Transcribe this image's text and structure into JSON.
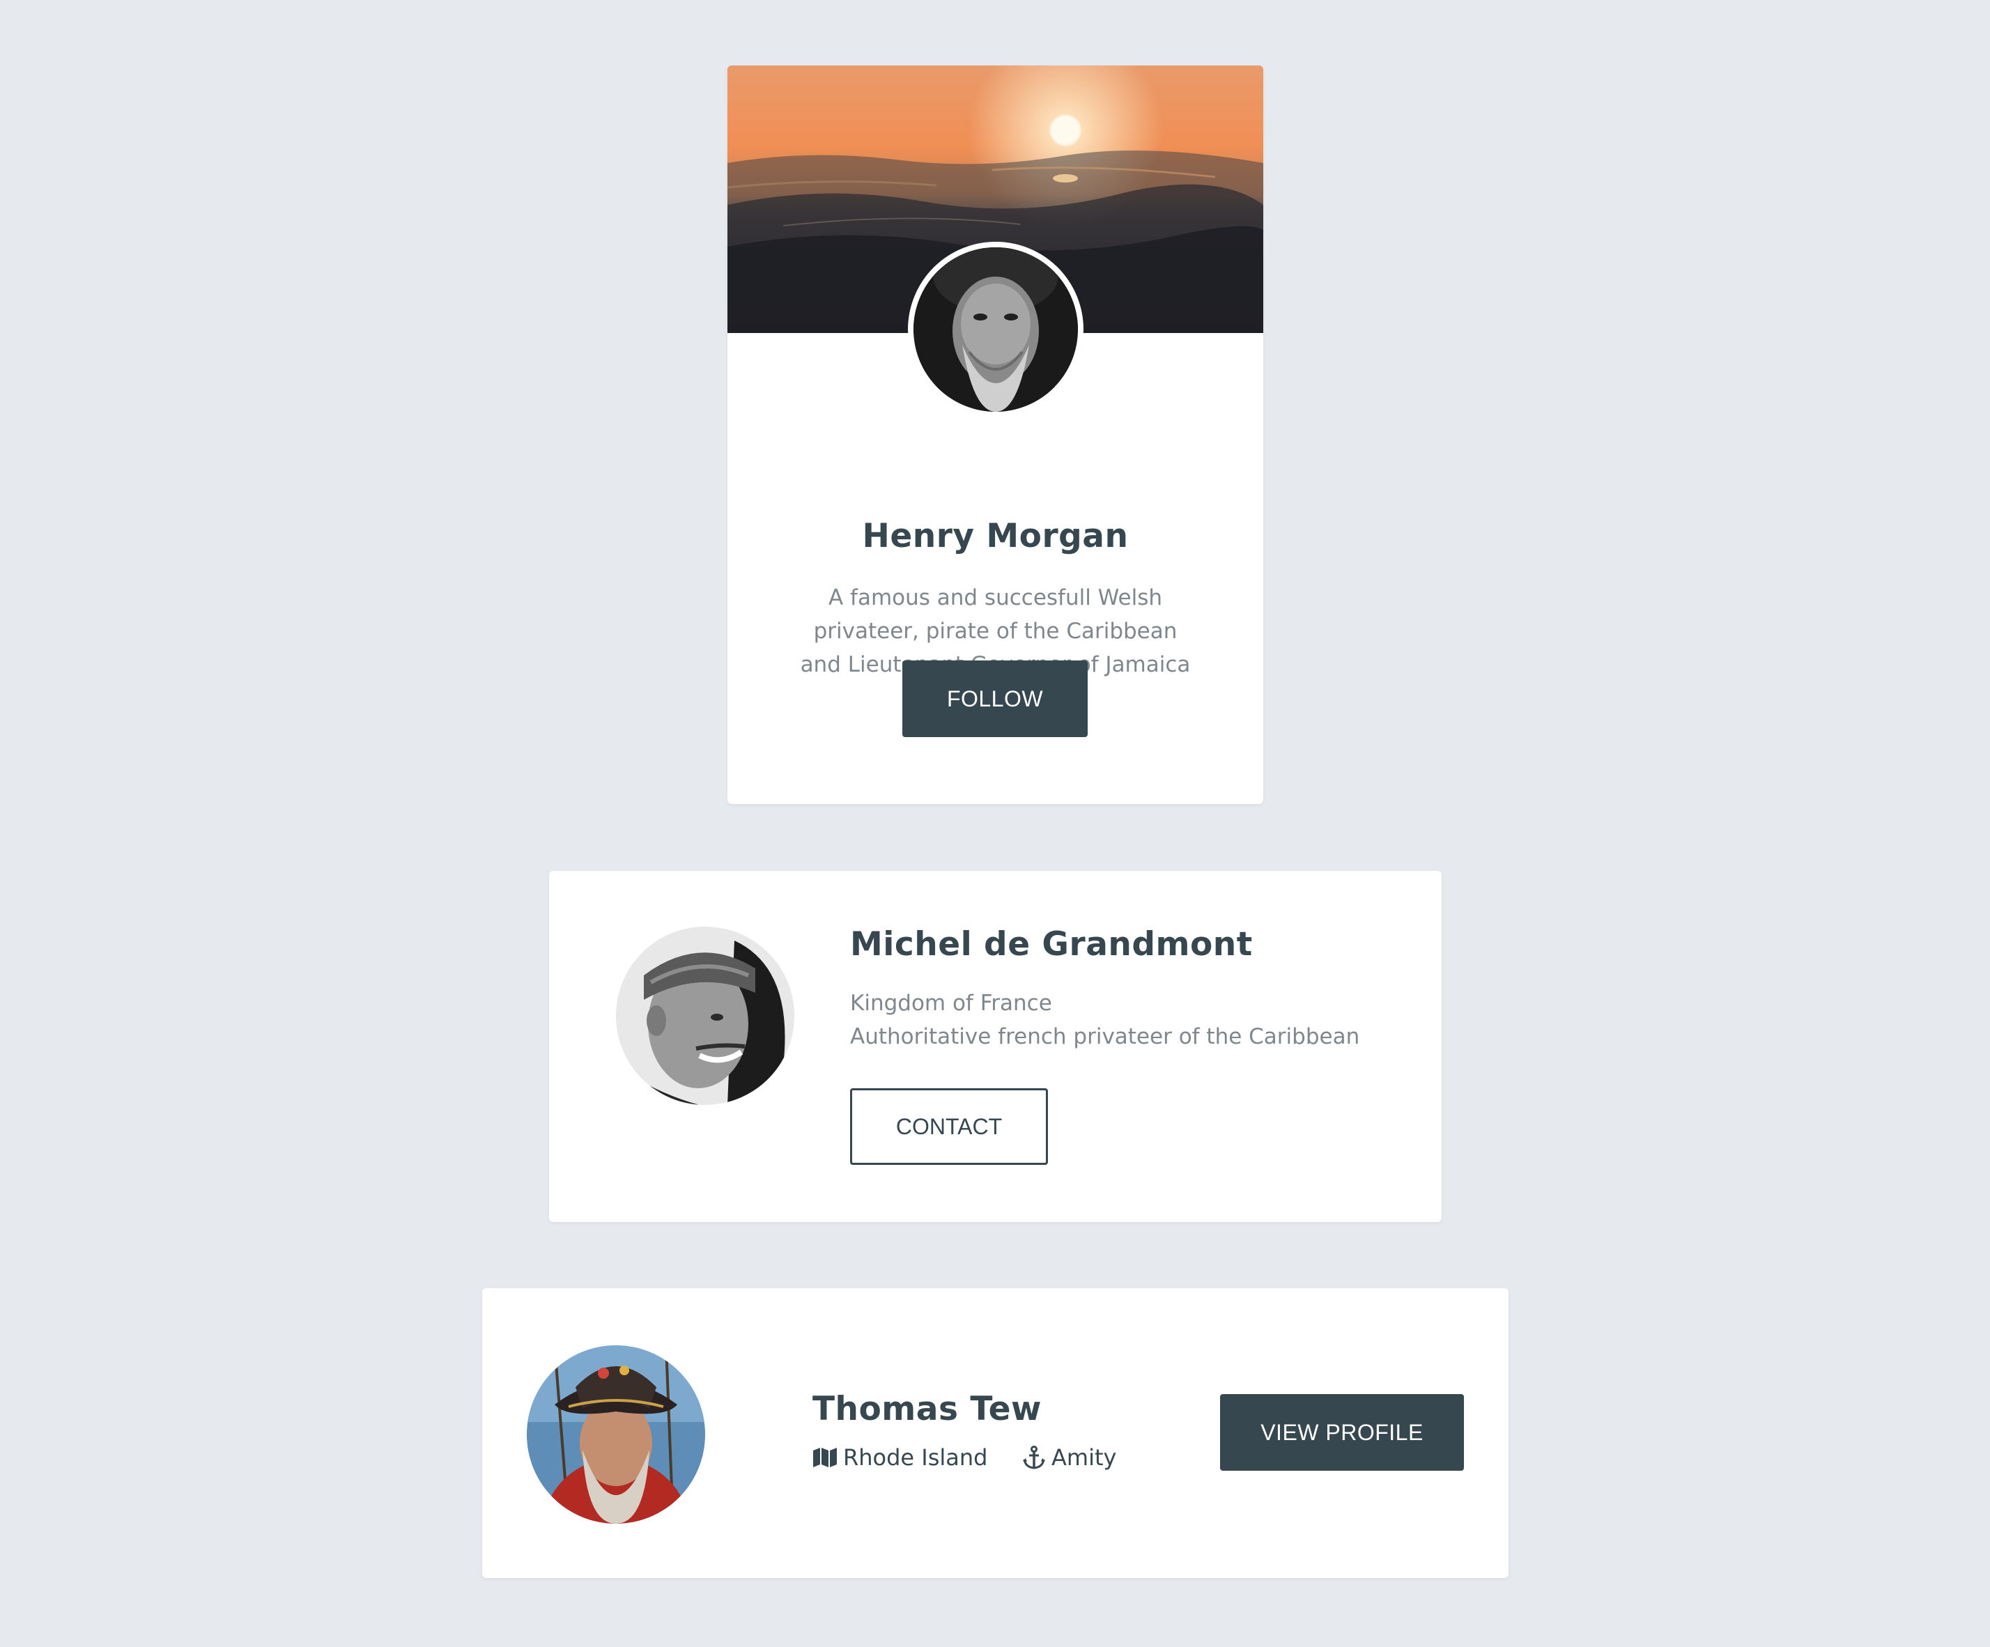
{
  "colors": {
    "background": "#e6eaee",
    "card": "#ffffff",
    "primary": "#37474f",
    "muted_text": "#80878c"
  },
  "profile_card": {
    "banner_image": "ocean-sunset",
    "avatar_image": "bearded-man-portrait",
    "name": "Henry Morgan",
    "bio": "A famous and succesfull Welsh privateer, pirate of the Caribbean and Lieutenant Governor of Jamaica",
    "button_label": "FOLLOW"
  },
  "contact_card": {
    "avatar_image": "man-with-bandana-portrait",
    "name": "Michel de Grandmont",
    "line1": "Kingdom of France",
    "line2": "Authoritative french privateer of the Caribbean",
    "button_label": "CONTACT"
  },
  "list_card": {
    "avatar_image": "pirate-captain-portrait",
    "name": "Thomas Tew",
    "location_icon": "map-icon",
    "location": "Rhode Island",
    "ship_icon": "anchor-icon",
    "ship": "Amity",
    "button_label": "VIEW PROFILE"
  }
}
